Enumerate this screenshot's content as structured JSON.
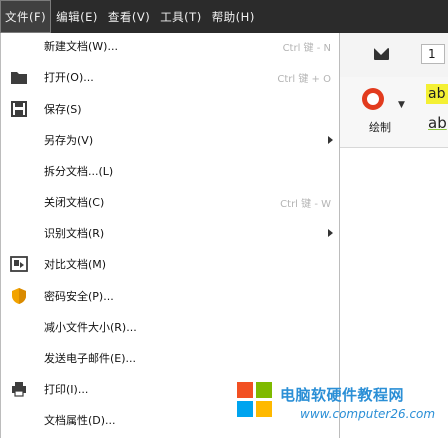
{
  "menubar": {
    "items": [
      {
        "label": "文件(F)",
        "active": true
      },
      {
        "label": "编辑(E)",
        "active": false
      },
      {
        "label": "查看(V)",
        "active": false
      },
      {
        "label": "工具(T)",
        "active": false
      },
      {
        "label": "帮助(H)",
        "active": false
      }
    ]
  },
  "toolbar": {
    "page_value": "1",
    "draw_label": "绘制",
    "text_style_1": "ab",
    "text_style_2": "ab"
  },
  "file_menu": {
    "items": [
      {
        "label": "新建文档(W)...",
        "shortcut": "Ctrl 键 - N",
        "icon": "none"
      },
      {
        "label": "打开(O)...",
        "shortcut": "Ctrl 键 + O",
        "icon": "folder-icon"
      },
      {
        "label": "保存(S)",
        "shortcut": "",
        "icon": "save-icon"
      },
      {
        "label": "另存为(V)",
        "shortcut": "",
        "submenu": true,
        "icon": "none"
      },
      {
        "label": "拆分文档...(L)",
        "shortcut": "",
        "icon": "none"
      },
      {
        "label": "关闭文档(C)",
        "shortcut": "Ctrl 键 - W",
        "icon": "none"
      },
      {
        "label": "识别文档(R)",
        "shortcut": "",
        "submenu": true,
        "icon": "none"
      },
      {
        "label": "对比文档(M)",
        "shortcut": "",
        "icon": "compare-icon"
      },
      {
        "label": "密码安全(P)...",
        "shortcut": "",
        "icon": "shield-icon"
      },
      {
        "label": "减小文件大小(R)...",
        "shortcut": "",
        "icon": "none"
      },
      {
        "label": "发送电子邮件(E)...",
        "shortcut": "",
        "icon": "none"
      },
      {
        "label": "打印(I)...",
        "shortcut": "",
        "icon": "printer-icon"
      },
      {
        "label": "文档属性(D)...",
        "shortcut": "",
        "icon": "none"
      }
    ]
  },
  "watermark": {
    "title": "电脑软硬件教程网",
    "url": "www.computer26.com",
    "colors": [
      "#f25022",
      "#7fba00",
      "#00a4ef",
      "#ffb900"
    ]
  }
}
